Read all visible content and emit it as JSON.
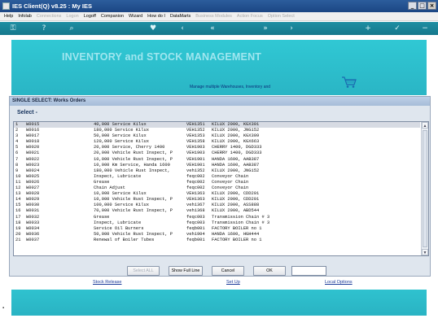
{
  "window": {
    "title": "IES Client(Q) v8.25 : My IES",
    "minimize": "_",
    "maximize": "□",
    "close": "×"
  },
  "menu": {
    "items": [
      {
        "label": "Help",
        "enabled": true
      },
      {
        "label": "Infolab",
        "enabled": true
      },
      {
        "label": "Connections",
        "enabled": false
      },
      {
        "label": "Logon",
        "enabled": false
      },
      {
        "label": "Logoff",
        "enabled": true
      },
      {
        "label": "Companion",
        "enabled": true
      },
      {
        "label": "Wizard",
        "enabled": true
      },
      {
        "label": "How do I",
        "enabled": true
      },
      {
        "label": "DataMarts",
        "enabled": true
      },
      {
        "label": "Business Modules",
        "enabled": false
      },
      {
        "label": "Action Focus",
        "enabled": false
      },
      {
        "label": "Option Select",
        "enabled": false
      }
    ]
  },
  "toolbar": {
    "icons": [
      "key-icon",
      "help-icon",
      "search-icon",
      "heart-icon",
      "back-icon",
      "rewind-icon",
      "forward-icon",
      "fast-forward-icon",
      "add-icon",
      "check-icon",
      "minus-icon"
    ]
  },
  "banner": {
    "heading": "INVENTORY and STOCK MANAGEMENT",
    "subtext": "Manage multiple Warehouses, Inventory and",
    "icon": "shopping-cart-icon"
  },
  "dialog": {
    "title": "SINGLE SELECT: Works Orders",
    "select_label": "Select -",
    "rows": [
      {
        "n": "1",
        "code": "W0015",
        "desc": "40,000 Service Kilux",
        "ref": "VEH1351",
        "asset": "KILUX 2000, KGX301"
      },
      {
        "n": "2",
        "code": "W0016",
        "desc": "180,000 Service Kilux",
        "ref": "VEH1352",
        "asset": "KILUX 2000, JNG152"
      },
      {
        "n": "3",
        "code": "W0017",
        "desc": "50,000 Service Kilux",
        "ref": "VEH1353",
        "asset": "KILUX 2000, KGX309"
      },
      {
        "n": "4",
        "code": "W0018",
        "desc": "120,000 Service Kilux",
        "ref": "VEH1358",
        "asset": "KILUX 2000, KGX663"
      },
      {
        "n": "5",
        "code": "W0020",
        "desc": "20,000 Service, Cherry 1400",
        "ref": "VEH1903",
        "asset": "CHERRY 1400, DGD333"
      },
      {
        "n": "6",
        "code": "W0021",
        "desc": "20,000 Vehicle Rust Inspect, P",
        "ref": "VEH1903",
        "asset": "CHERRY 1400, DGD333"
      },
      {
        "n": "7",
        "code": "W0022",
        "desc": "10,000 Vehicle Rust Inspect, P",
        "ref": "VEH1901",
        "asset": "HANDA 1600, AAB387"
      },
      {
        "n": "8",
        "code": "W0023",
        "desc": "10,000 Km Service, Handa 1600",
        "ref": "VEH1901",
        "asset": "HANDA 1600, AAB387"
      },
      {
        "n": "9",
        "code": "W0024",
        "desc": "180,000 Vehicle Rust Inspect,",
        "ref": "veh1352",
        "asset": "KILUX 2000, JNG152"
      },
      {
        "n": "10",
        "code": "W0025",
        "desc": "Inspect, Lubricate",
        "ref": "feqc002",
        "asset": "Conveyor Chain"
      },
      {
        "n": "11",
        "code": "W0026",
        "desc": "Grease",
        "ref": "feqc002",
        "asset": "Conveyor Chain"
      },
      {
        "n": "12",
        "code": "W0027",
        "desc": "Chain Adjust",
        "ref": "feqc002",
        "asset": "Conveyor Chain"
      },
      {
        "n": "13",
        "code": "W0028",
        "desc": "10,000 Service Kilux",
        "ref": "VEH1363",
        "asset": "KILUX 2000, CDD201"
      },
      {
        "n": "14",
        "code": "W0029",
        "desc": "10,000 Vehicle Rust Inspect, P",
        "ref": "VEH1363",
        "asset": "KILUX 2000, CDD201"
      },
      {
        "n": "15",
        "code": "W0030",
        "desc": "100,000 Service Kilux",
        "ref": "veh1367",
        "asset": "KILUX 2000, ASS888"
      },
      {
        "n": "16",
        "code": "W0031",
        "desc": "70,000 Vehicle Rust Inspect, P",
        "ref": "veh1368",
        "asset": "KILUX 2000, ABD544"
      },
      {
        "n": "17",
        "code": "W0032",
        "desc": "Grease",
        "ref": "feqc003",
        "asset": "Transmission Chain # 3"
      },
      {
        "n": "18",
        "code": "W0033",
        "desc": "Inspect, Lubricate",
        "ref": "feqc003",
        "asset": "Transmission Chain # 3"
      },
      {
        "n": "19",
        "code": "W0034",
        "desc": "Service Oil Burners",
        "ref": "feqb001",
        "asset": "FACTORY BOILER no 1"
      },
      {
        "n": "20",
        "code": "W0036",
        "desc": "50,000 Vehicle Rust Inspect, P",
        "ref": "veh1904",
        "asset": "HANDA 1600, HGH444"
      },
      {
        "n": "21",
        "code": "W0037",
        "desc": "Renewal of Boiler Tubes",
        "ref": "feqb001",
        "asset": "FACTORY BOILER no 1"
      }
    ],
    "buttons": {
      "select_all": "Select ALL",
      "show_full_line": "Show Full Line",
      "cancel": "Cancel",
      "ok": "OK"
    },
    "ok_input_value": ""
  },
  "links": {
    "stock_release": "Stock Release",
    "set_up": "Set Up",
    "local_options": "Local Options"
  }
}
